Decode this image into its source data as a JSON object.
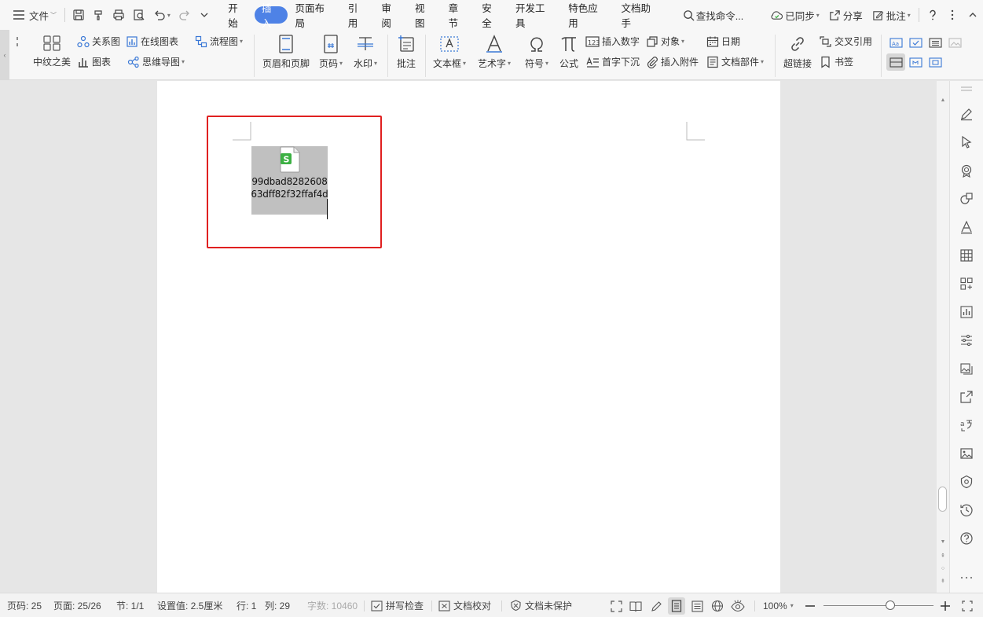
{
  "menubar": {
    "file_label": "文件",
    "tabs": [
      "开始",
      "插入",
      "页面布局",
      "引用",
      "审阅",
      "视图",
      "章节",
      "安全",
      "开发工具",
      "特色应用",
      "文档助手"
    ],
    "active_tab_index": 1,
    "search_placeholder": "查找命令...",
    "sync_label": "已同步",
    "share_label": "分享",
    "comment_label": "批注"
  },
  "ribbon": {
    "items": {
      "middle_suffix": "中纹之美",
      "relation": "关系图",
      "online_chart": "在线图表",
      "flowchart": "流程图",
      "chart": "图表",
      "mindmap": "思维导图",
      "header_footer": "页眉和页脚",
      "page_number": "页码",
      "watermark": "水印",
      "comment": "批注",
      "textbox": "文本框",
      "wordart": "艺术字",
      "symbol": "符号",
      "formula": "公式",
      "insert_number": "插入数字",
      "object": "对象",
      "date": "日期",
      "dropcap": "首字下沉",
      "attachment": "插入附件",
      "doc_parts": "文档部件",
      "hyperlink": "超链接",
      "cross_ref": "交叉引用",
      "bookmark": "书签"
    }
  },
  "document": {
    "attachment": {
      "filename_line1": "99dbad8282608",
      "filename_line2": "63dff82f32ffaf4d",
      "icon_letter": "S",
      "icon_color": "#3cb043"
    },
    "highlight_color": "#e02020"
  },
  "statusbar": {
    "page_num": "页码: 25",
    "pages": "页面: 25/26",
    "section": "节: 1/1",
    "setting": "设置值: 2.5厘米",
    "row": "行: 1",
    "col": "列: 29",
    "word_count": "字数: 10460",
    "spellcheck": "拼写检查",
    "proofread": "文档校对",
    "protect": "文档未保护",
    "zoom": "100%",
    "zoom_percent": 100
  },
  "colors": {
    "accent": "#4e82e6",
    "highlight": "#e02020",
    "attachment_bg": "#c0c0c0"
  }
}
